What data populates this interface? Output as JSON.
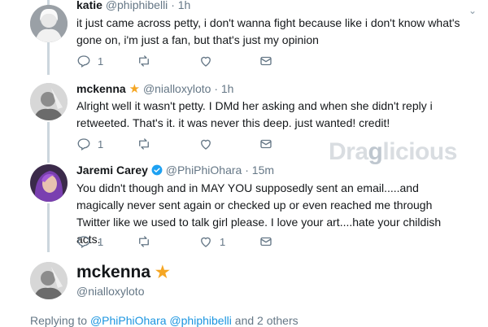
{
  "tweets": [
    {
      "name": "katie",
      "handle": "@phiphibelli",
      "sep": "·",
      "time": "1h",
      "text": "it just came across petty, i don't wanna fight because like i don't know what's gone on, i'm just a fan, but that's just my opinion",
      "reply_count": "1",
      "retweet_count": "",
      "like_count": ""
    },
    {
      "name": "mckenna",
      "badge": "★",
      "handle": "@nialloxyloto",
      "sep": "·",
      "time": "1h",
      "text": "Alright well it wasn't petty. I DMd her asking and when she didn't reply i retweeted. That's it. it was never this deep. just wanted! credit!",
      "reply_count": "1",
      "retweet_count": "",
      "like_count": ""
    },
    {
      "name": "Jaremi Carey",
      "handle": "@PhiPhiOhara",
      "sep": "·",
      "time": "15m",
      "text": "You didn't though and in MAY YOU supposedly sent an email.....and magically never sent again or checked up or even reached me through Twitter like we used to talk girl please. I love your art....hate your childish acts.",
      "reply_count": "1",
      "retweet_count": "",
      "like_count": "1"
    }
  ],
  "main_tweet": {
    "name": "mckenna",
    "badge": "★",
    "handle": "@nialloxyloto",
    "replying_prefix": "Replying to",
    "replying_to": "@PhiPhiOhara @phiphibelli",
    "replying_suffix": "and 2 others"
  },
  "watermark": {
    "part1": "Dra",
    "part2": "g",
    "part3": "licious"
  },
  "colors": {
    "accent": "#1b95e0",
    "muted": "#657786",
    "star": "#f5a623",
    "verified": "#1da1f2"
  },
  "icons": [
    "reply-icon",
    "retweet-icon",
    "like-icon",
    "dm-icon",
    "verified-icon",
    "chevron-down-icon"
  ]
}
